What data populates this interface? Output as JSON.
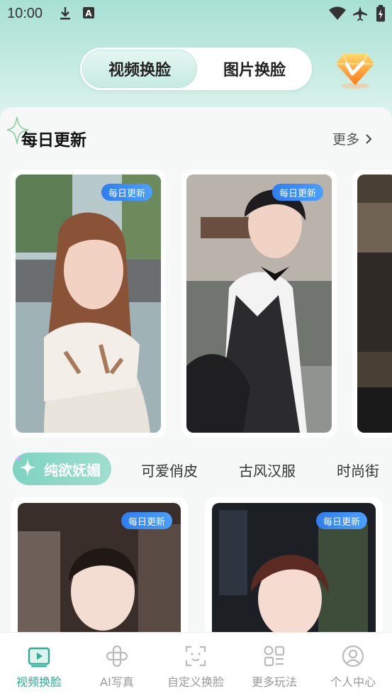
{
  "status_bar": {
    "time": "10:00"
  },
  "top_switch": {
    "tab_video": "视频换脸",
    "tab_image": "图片换脸",
    "active": "tab_video"
  },
  "daily": {
    "title": "每日更新",
    "more": "更多",
    "cards": [
      {
        "tag": "每日更新"
      },
      {
        "tag": "每日更新"
      },
      {
        "tag": ""
      }
    ]
  },
  "categories": [
    "纯欲妩媚",
    "可爱俏皮",
    "古风汉服",
    "时尚街"
  ],
  "active_category": "纯欲妩媚",
  "grid": [
    {
      "tag": "每日更新"
    },
    {
      "tag": "每日更新"
    }
  ],
  "bottom_nav": [
    {
      "label": "视频换脸",
      "icon": "video-icon",
      "active": true
    },
    {
      "label": "AI写真",
      "icon": "ai-portrait-icon",
      "active": false
    },
    {
      "label": "自定义换脸",
      "icon": "face-scan-icon",
      "active": false
    },
    {
      "label": "更多玩法",
      "icon": "grid-more-icon",
      "active": false
    },
    {
      "label": "个人中心",
      "icon": "profile-icon",
      "active": false
    }
  ],
  "colors": {
    "accent": "#2faa96",
    "tag_blue": "#3a8cf5",
    "category_active": "#8ad8c8"
  }
}
